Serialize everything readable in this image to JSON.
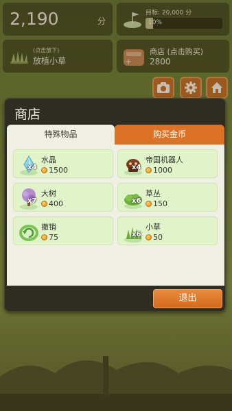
{
  "hud": {
    "score": "2,190",
    "score_unit": "分",
    "goal_text": "目标: 20,000 分",
    "goal_progress_label": "10%",
    "goal_progress": 0.1,
    "plant_hint": "(点击放下)",
    "plant_label": "放植小草",
    "shop_label": "商店 (点击购买)",
    "shop_coins": "2800"
  },
  "dialog": {
    "title": "商店",
    "tabs": [
      {
        "label": "特殊物品",
        "active": true
      },
      {
        "label": "购买金币",
        "active": false
      }
    ],
    "items": [
      {
        "name": "水晶",
        "price": "1500",
        "qty": "x4",
        "icon": "crystal-icon"
      },
      {
        "name": "帝国机器人",
        "price": "1000",
        "qty": "x4",
        "icon": "robot-icon"
      },
      {
        "name": "大树",
        "price": "400",
        "qty": "x7",
        "icon": "tree-icon"
      },
      {
        "name": "草丛",
        "price": "150",
        "qty": "x6",
        "icon": "bush-icon"
      },
      {
        "name": "撤销",
        "price": "75",
        "qty": "",
        "icon": "undo-icon"
      },
      {
        "name": "小草",
        "price": "50",
        "qty": "x6",
        "icon": "grass-icon"
      }
    ],
    "exit_label": "退出"
  },
  "colors": {
    "accent": "#dc7226",
    "dialog_bg": "#2f2d22",
    "item_bg": "#e0f3c9"
  }
}
